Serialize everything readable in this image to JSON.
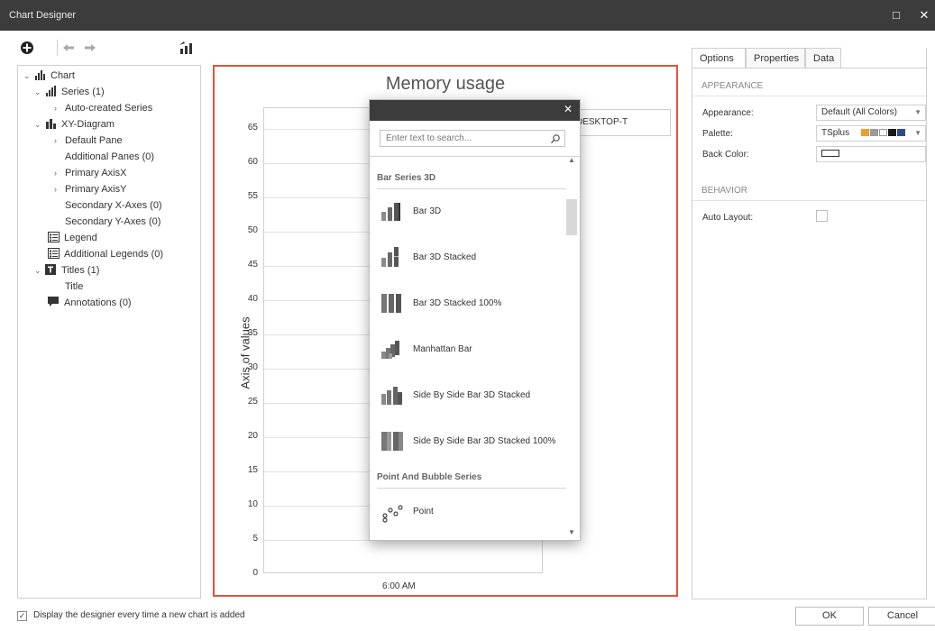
{
  "window": {
    "title": "Chart Designer",
    "maximize_glyph": "□",
    "close_glyph": "✕"
  },
  "toolbar": {
    "icons": [
      "add-icon",
      "undo-icon",
      "redo-icon",
      "chart-wizard-icon"
    ]
  },
  "tree": {
    "items": [
      {
        "label": "Chart",
        "chev": "⌄",
        "icon": "chart-icon"
      },
      {
        "label": "Series (1)",
        "chev": "⌄",
        "icon": "series-icon"
      },
      {
        "label": "Auto-created Series",
        "chev": "›"
      },
      {
        "label": "XY-Diagram",
        "chev": "⌄",
        "icon": "diagram-icon"
      },
      {
        "label": "Default Pane",
        "chev": "›"
      },
      {
        "label": "Additional Panes (0)",
        "chev": ""
      },
      {
        "label": "Primary AxisX",
        "chev": "›"
      },
      {
        "label": "Primary AxisY",
        "chev": "›"
      },
      {
        "label": "Secondary X-Axes (0)",
        "chev": ""
      },
      {
        "label": "Secondary Y-Axes (0)",
        "chev": ""
      },
      {
        "label": "Legend",
        "chev": "",
        "icon": "legend-icon"
      },
      {
        "label": "Additional Legends (0)",
        "chev": "",
        "icon": "legend-icon"
      },
      {
        "label": "Titles (1)",
        "chev": "⌄",
        "icon": "title-icon"
      },
      {
        "label": "Title",
        "chev": ""
      },
      {
        "label": "Annotations (0)",
        "chev": "",
        "icon": "annotation-icon"
      }
    ]
  },
  "chart": {
    "legend_text": "DESKTOP-T"
  },
  "chart_data": {
    "type": "line",
    "title": "Memory usage",
    "xlabel": "",
    "ylabel": "Axis of values",
    "x_tick_labels": [
      "6:00 AM"
    ],
    "y_ticks": [
      0,
      5,
      10,
      15,
      20,
      25,
      30,
      35,
      40,
      45,
      50,
      55,
      60,
      65
    ],
    "ylim": [
      0,
      68
    ],
    "grid": true,
    "legend": "top-right",
    "series": [
      {
        "name": "DESKTOP-T",
        "values": []
      }
    ]
  },
  "popup": {
    "close_glyph": "✕",
    "search_placeholder": "Enter text to search...",
    "groups": [
      {
        "title": "Bar Series 3D",
        "items": [
          {
            "label": "Bar 3D",
            "icon": "bar-3d-icon"
          },
          {
            "label": "Bar 3D Stacked",
            "icon": "bar-3d-stacked-icon"
          },
          {
            "label": "Bar 3D Stacked 100%",
            "icon": "bar-3d-stacked-100-icon"
          },
          {
            "label": "Manhattan Bar",
            "icon": "manhattan-bar-icon"
          },
          {
            "label": "Side By Side Bar 3D Stacked",
            "icon": "side-by-side-bar-3d-stacked-icon"
          },
          {
            "label": "Side By Side Bar 3D Stacked 100%",
            "icon": "side-by-side-bar-3d-stacked-100-icon"
          }
        ]
      },
      {
        "title": "Point And Bubble Series",
        "items": [
          {
            "label": "Point",
            "icon": "point-icon"
          }
        ]
      }
    ]
  },
  "properties": {
    "tabs": [
      "Options",
      "Properties",
      "Data"
    ],
    "active_tab": "Options",
    "appearance_section": "APPEARANCE",
    "behavior_section": "BEHAVIOR",
    "appearance_label": "Appearance:",
    "appearance_value": "Default (All Colors)",
    "palette_label": "Palette:",
    "palette_value": "TSplus",
    "palette_colors": [
      "#e8a02c",
      "#9a9a9a",
      "#ffffff",
      "#1a1a1a",
      "#2e4a8c"
    ],
    "back_color_label": "Back Color:",
    "auto_layout_label": "Auto Layout:"
  },
  "footer": {
    "checkbox_checked": true,
    "check_glyph": "✓",
    "checkbox_label": "Display the designer every time a new chart is added",
    "ok_label": "OK",
    "cancel_label": "Cancel"
  }
}
